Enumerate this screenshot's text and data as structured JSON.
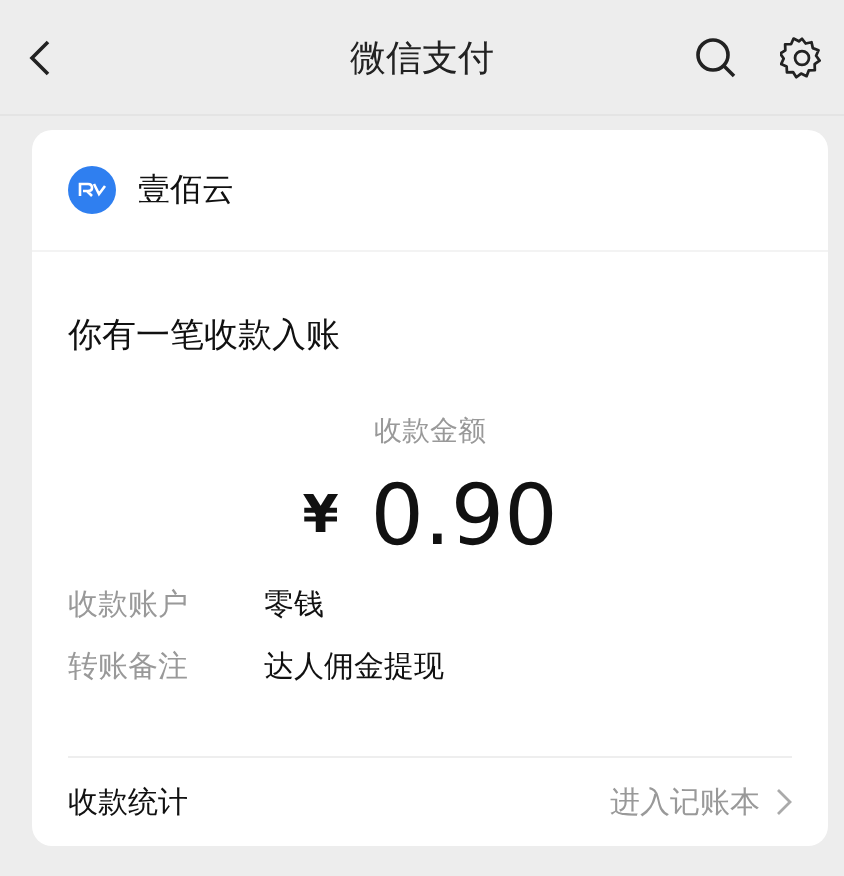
{
  "header": {
    "title": "微信支付"
  },
  "merchant": {
    "name": "壹佰云"
  },
  "notice": "你有一笔收款入账",
  "amount": {
    "label": "收款金额",
    "currency": "¥",
    "value": "0.90"
  },
  "details": [
    {
      "label": "收款账户",
      "value": "零钱"
    },
    {
      "label": "转账备注",
      "value": "达人佣金提现"
    }
  ],
  "footer": {
    "label": "收款统计",
    "link": "进入记账本"
  }
}
